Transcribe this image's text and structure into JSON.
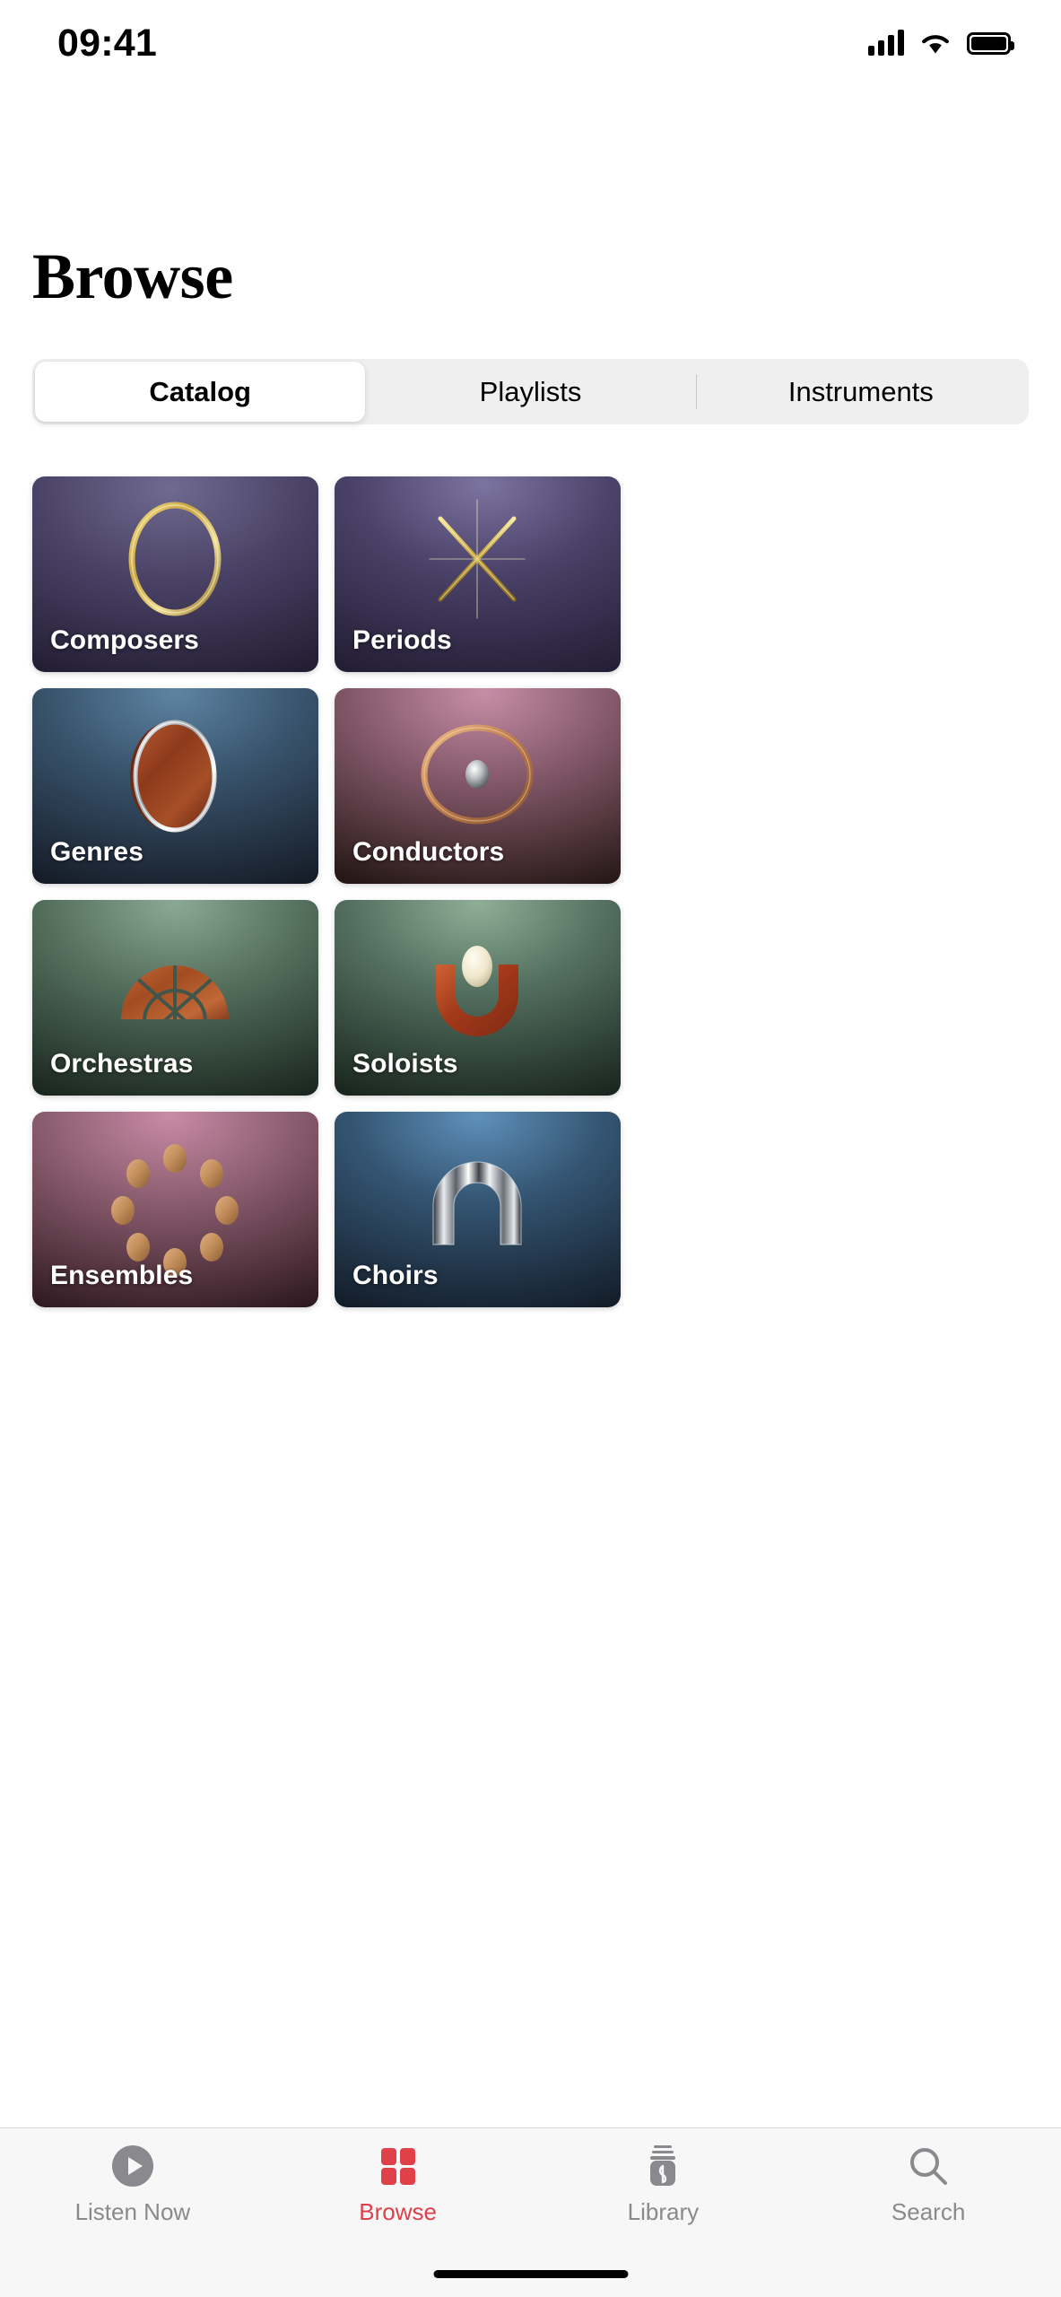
{
  "status_bar": {
    "time": "09:41",
    "cellular_icon": "cellular-signal-icon",
    "wifi_icon": "wifi-icon",
    "battery_icon": "battery-full-icon"
  },
  "header": {
    "title": "Browse"
  },
  "segmented_control": {
    "selected": "Catalog",
    "segments": [
      {
        "label": "Catalog",
        "selected": true
      },
      {
        "label": "Playlists",
        "selected": false
      },
      {
        "label": "Instruments",
        "selected": false
      }
    ]
  },
  "grid": {
    "cards": [
      {
        "label": "Composers",
        "art": "golden-ring-icon",
        "bg_top": "#5b5378",
        "bg_bottom": "#262137",
        "accent": "#d9b84f"
      },
      {
        "label": "Periods",
        "art": "gold-asterisk-icon",
        "bg_top": "#5e5680",
        "bg_bottom": "#262036",
        "accent": "#d8ba52"
      },
      {
        "label": "Genres",
        "art": "wood-drum-silver-rim-icon",
        "bg_top": "#4a6f8c",
        "bg_bottom": "#161c27",
        "accent": "#8e3a20"
      },
      {
        "label": "Conductors",
        "art": "copper-ring-silver-ball-icon",
        "bg_top": "#9b6b84",
        "bg_bottom": "#2a1918",
        "accent": "#c98d5e"
      },
      {
        "label": "Orchestras",
        "art": "wood-arch-fan-icon",
        "bg_top": "#6c8c77",
        "bg_bottom": "#1c2a22",
        "accent": "#b5572c"
      },
      {
        "label": "Soloists",
        "art": "wood-u-cream-ball-icon",
        "bg_top": "#79977f",
        "bg_bottom": "#1b2921",
        "accent": "#c0491f"
      },
      {
        "label": "Ensembles",
        "art": "wood-disc-circle-icon",
        "bg_top": "#b27792",
        "bg_bottom": "#30191f",
        "accent": "#c79368"
      },
      {
        "label": "Choirs",
        "art": "chrome-dome-icon",
        "bg_top": "#4d7ea8",
        "bg_bottom": "#15202e",
        "accent": "#dcdcdc"
      }
    ]
  },
  "tab_bar": {
    "active": "Browse",
    "accent_color": "#e0404a",
    "inactive_color": "#8a8a8e",
    "tabs": [
      {
        "label": "Listen Now",
        "icon": "play-circle-icon",
        "active": false
      },
      {
        "label": "Browse",
        "icon": "grid-squares-icon",
        "active": true
      },
      {
        "label": "Library",
        "icon": "music-library-icon",
        "active": false
      },
      {
        "label": "Search",
        "icon": "search-icon",
        "active": false
      }
    ]
  },
  "home_indicator": "home-indicator"
}
